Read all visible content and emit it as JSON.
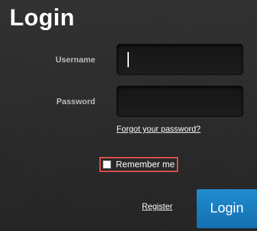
{
  "page": {
    "title": "Login"
  },
  "form": {
    "username_label": "Username",
    "username_value": "",
    "password_label": "Password",
    "password_value": "",
    "forgot_link": "Forgot your password?",
    "remember_label": "Remember me",
    "remember_checked": false,
    "register_link": "Register",
    "login_button": "Login"
  },
  "colors": {
    "accent": "#1a7dc2",
    "highlight_border": "#e2524b"
  }
}
